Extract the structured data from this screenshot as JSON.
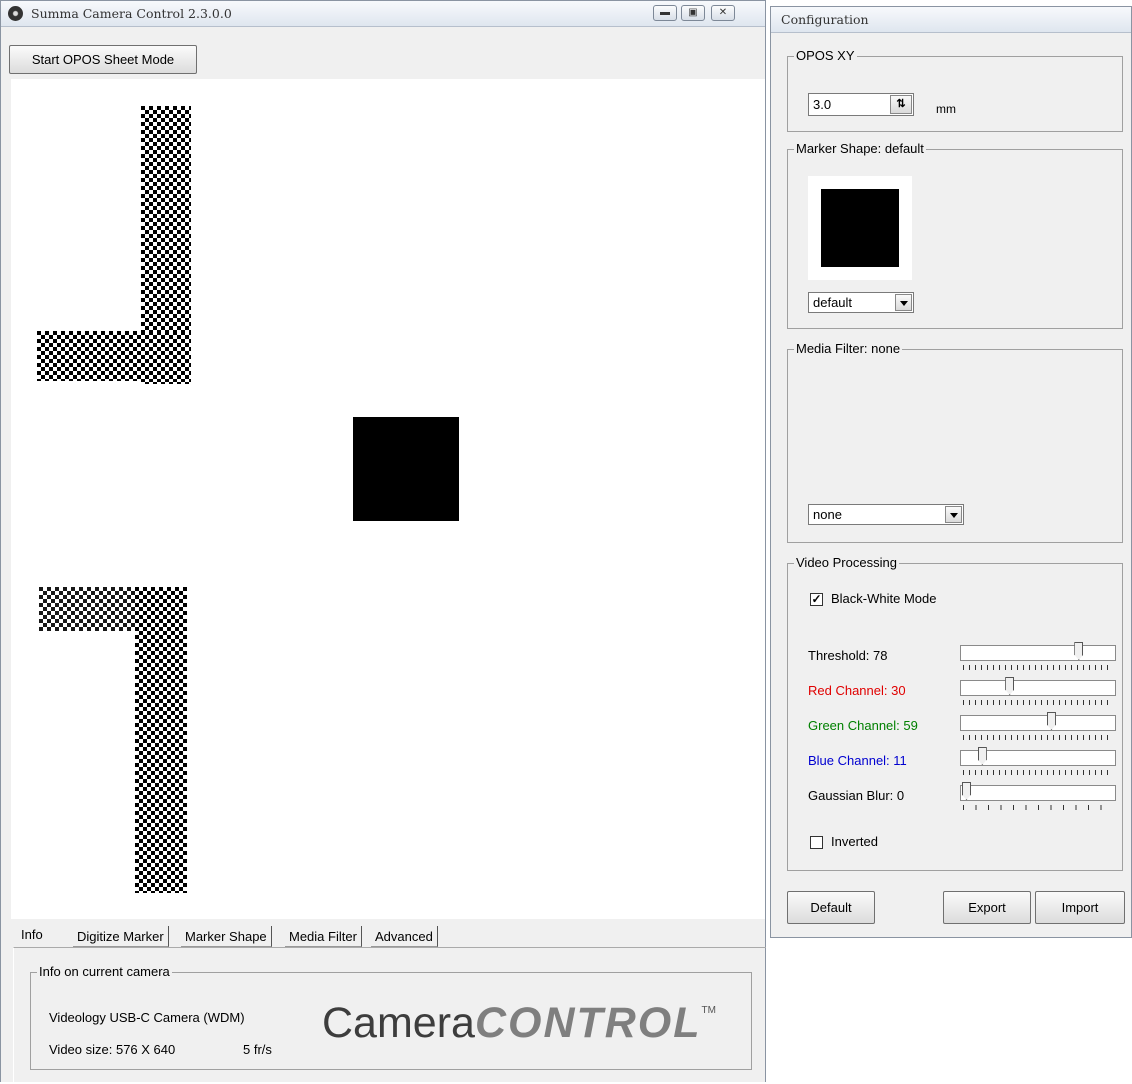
{
  "main_window": {
    "title": "Summa Camera Control 2.3.0.0",
    "start_button": "Start OPOS Sheet Mode",
    "tabs": [
      {
        "label": "Info",
        "active": true
      },
      {
        "label": "Digitize Marker",
        "active": false
      },
      {
        "label": "Marker Shape",
        "active": false
      },
      {
        "label": "Media Filter",
        "active": false
      },
      {
        "label": "Advanced",
        "active": false
      }
    ],
    "info_panel": {
      "group_title": "Info on current camera",
      "camera_name": "Videology USB-C Camera (WDM)",
      "video_size": "Video size: 576 X 640",
      "frame_rate": "5 fr/s",
      "logo_text_1": "Camera",
      "logo_text_2": "CONTROL",
      "logo_tm": "TM"
    }
  },
  "config_window": {
    "title": "Configuration",
    "opos_xy": {
      "group_title": "OPOS XY",
      "value": "3.0",
      "unit": "mm"
    },
    "marker_shape": {
      "group_title": "Marker Shape: default",
      "selected": "default"
    },
    "media_filter": {
      "group_title": "Media Filter: none",
      "selected": "none"
    },
    "video_processing": {
      "group_title": "Video Processing",
      "black_white_label": "Black-White Mode",
      "black_white_checked": true,
      "sliders": [
        {
          "label": "Threshold: 78",
          "value": 78,
          "max": 100,
          "color": "#000000"
        },
        {
          "label": "Red Channel: 30",
          "value": 30,
          "max": 100,
          "color": "#e00000"
        },
        {
          "label": "Green Channel: 59",
          "value": 59,
          "max": 100,
          "color": "#008000"
        },
        {
          "label": "Blue Channel: 11",
          "value": 11,
          "max": 100,
          "color": "#0000d0"
        },
        {
          "label": "Gaussian Blur: 0",
          "value": 0,
          "max": 12,
          "color": "#000000"
        }
      ],
      "inverted_label": "Inverted",
      "inverted_checked": false
    },
    "buttons": {
      "default": "Default",
      "export": "Export",
      "import": "Import"
    }
  },
  "icons": {
    "app_icon": "camera-lens-icon",
    "minimize": "minimize-icon",
    "maximize": "maximize-icon",
    "close": "close-icon"
  }
}
